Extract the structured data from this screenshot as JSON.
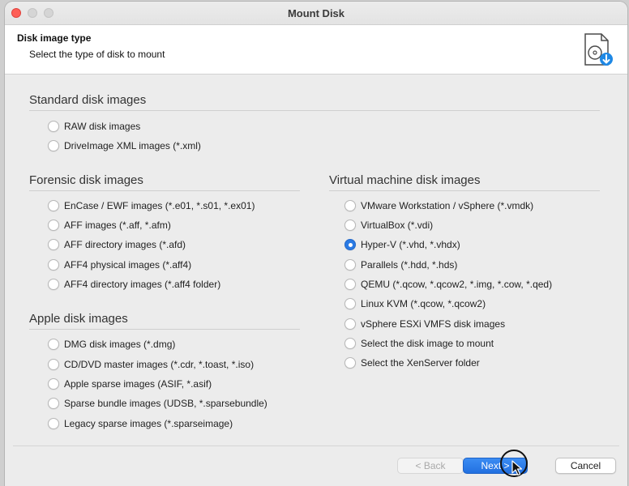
{
  "window": {
    "title": "Mount Disk"
  },
  "header": {
    "title": "Disk image type",
    "subtitle": "Select the type of disk to mount",
    "icon": "disk-download-icon"
  },
  "sections": {
    "standard": {
      "title": "Standard disk images",
      "options": [
        "RAW disk images",
        "DriveImage XML images (*.xml)"
      ]
    },
    "forensic": {
      "title": "Forensic disk images",
      "options": [
        "EnCase / EWF images (*.e01, *.s01, *.ex01)",
        "AFF images (*.aff, *.afm)",
        "AFF directory images (*.afd)",
        "AFF4 physical images (*.aff4)",
        "AFF4 directory images (*.aff4 folder)"
      ]
    },
    "apple": {
      "title": "Apple disk images",
      "options": [
        "DMG disk images (*.dmg)",
        "CD/DVD master images (*.cdr, *.toast, *.iso)",
        "Apple sparse images (ASIF, *.asif)",
        "Sparse bundle images (UDSB, *.sparsebundle)",
        "Legacy sparse images (*.sparseimage)"
      ]
    },
    "virtual": {
      "title": "Virtual machine disk images",
      "options": [
        "VMware Workstation / vSphere (*.vmdk)",
        "VirtualBox (*.vdi)",
        "Hyper-V (*.vhd, *.vhdx)",
        "Parallels (*.hdd, *.hds)",
        "QEMU (*.qcow, *.qcow2, *.img, *.cow, *.qed)",
        "Linux KVM (*.qcow, *.qcow2)",
        "vSphere ESXi VMFS disk images",
        "Select the disk image to mount",
        "Select the XenServer folder"
      ],
      "selected": "Hyper-V (*.vhd, *.vhdx)"
    }
  },
  "buttons": {
    "back": "< Back",
    "next": "Next >",
    "cancel": "Cancel"
  },
  "colors": {
    "accent": "#2a7ae4",
    "close": "#fe5f57"
  }
}
